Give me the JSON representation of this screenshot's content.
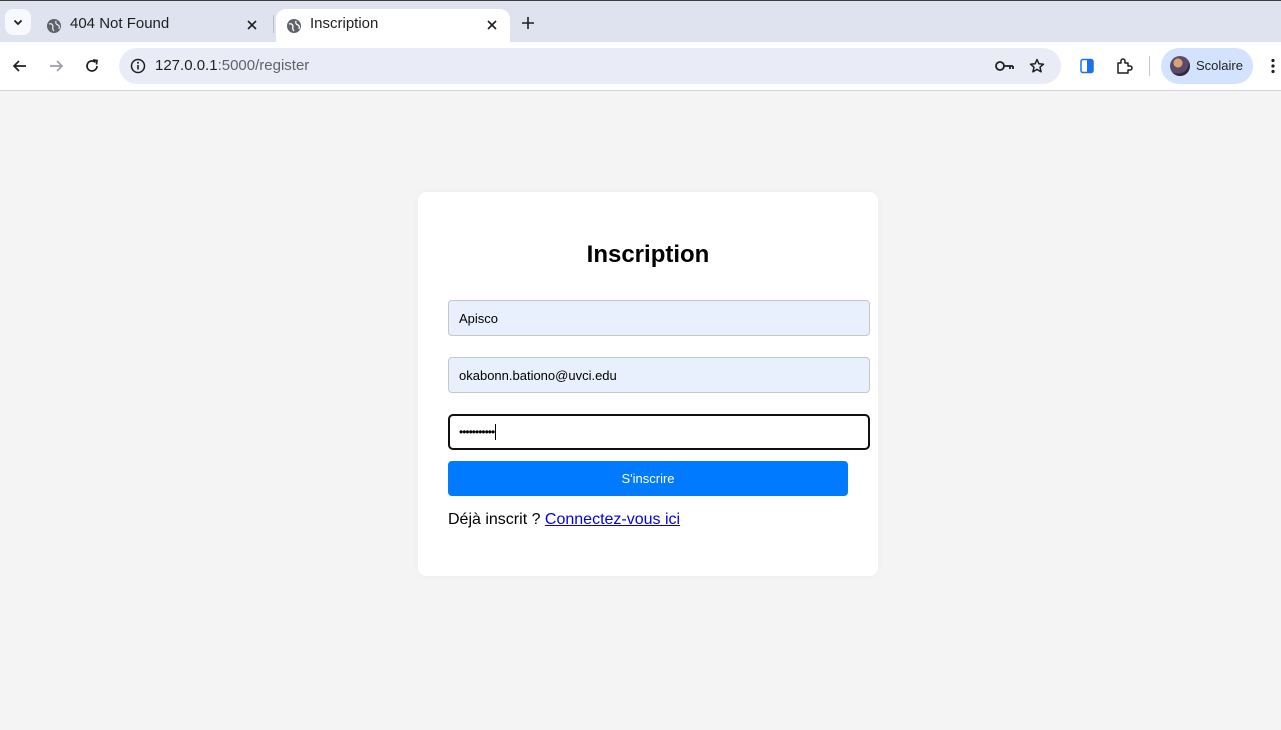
{
  "browser": {
    "tabs": [
      {
        "title": "404 Not Found",
        "active": false
      },
      {
        "title": "Inscription",
        "active": true
      }
    ],
    "url_host": "127.0.0.1",
    "url_path": ":5000/register",
    "profile_name": "Scolaire",
    "icons": [
      "tab-list-icon",
      "globe-icon",
      "close-icon",
      "plus-icon",
      "back-arrow-icon",
      "forward-arrow-icon",
      "reload-icon",
      "info-icon",
      "key-icon",
      "star-icon",
      "side-panel-icon",
      "extensions-icon",
      "kebab-menu-icon"
    ]
  },
  "form": {
    "title": "Inscription",
    "username_value": "Apisco",
    "email_value": "okabonn.bationo@uvci.edu",
    "password_masked": "•••••••••••",
    "submit_label": "S'inscrire",
    "login_prompt": "Déjà inscrit ? ",
    "login_link": "Connectez-vous ici"
  },
  "colors": {
    "accent": "#007bff",
    "page_bg": "#f4f4f4",
    "autofill_bg": "#e8f0fe",
    "link": "#0000ee"
  }
}
